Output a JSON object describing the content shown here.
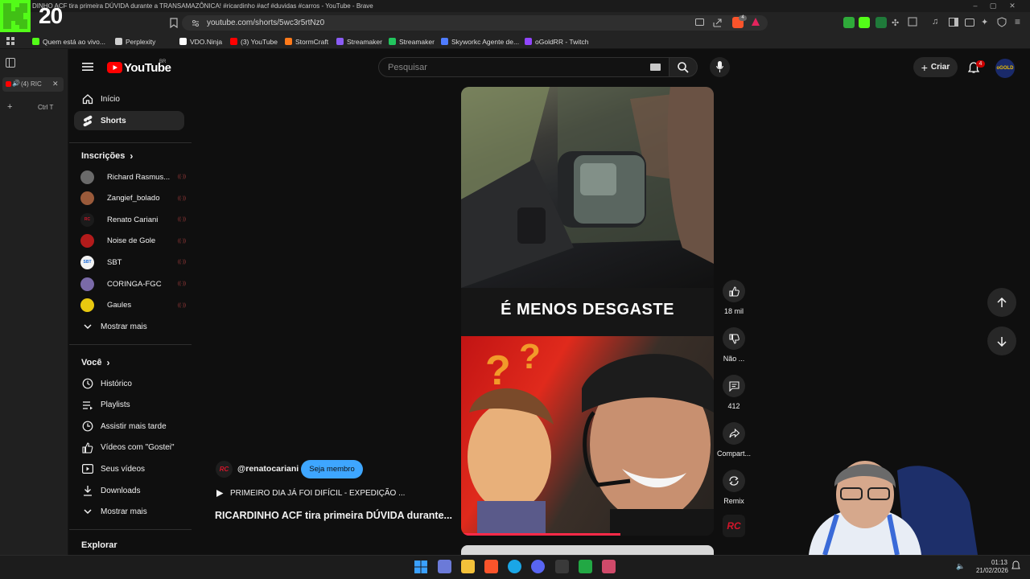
{
  "browser": {
    "window_title": "DINHO ACF tira primeira DÚVIDA durante a TRANSAMAZÔNICA! #ricardinho #acf #duvidas #carros - YouTube - Brave",
    "url": "youtube.com/shorts/5wc3r5rtNz0",
    "bookmarks": [
      {
        "label": "Quem está ao vivo...",
        "color": "#53fc18"
      },
      {
        "label": "Perplexity",
        "color": "#cfcfcf"
      },
      {
        "label": "VDO.Ninja",
        "color": "#ffffff"
      },
      {
        "label": "(3) YouTube",
        "color": "#ff0000"
      },
      {
        "label": "StormCraft",
        "color": "#ff7a1a"
      },
      {
        "label": "Streamaker",
        "color": "#8b5cf6"
      },
      {
        "label": "Streamaker",
        "color": "#22c55e"
      },
      {
        "label": "Skyworkc Agente de...",
        "color": "#4f7cff"
      },
      {
        "label": "oGoldRR - Twitch",
        "color": "#9146ff"
      }
    ],
    "tab": {
      "label": "(4) RIC",
      "new_tab_shortcut": "Ctrl T"
    },
    "shield_count": "4"
  },
  "overlay": {
    "count": "20",
    "brand_color": "#53fc18"
  },
  "youtube": {
    "logo": "YouTube",
    "country": "BR",
    "search_placeholder": "Pesquisar",
    "create_label": "Criar",
    "notifications": "4",
    "avatar_text": "oGOLD"
  },
  "sidebar": {
    "main": [
      {
        "label": "Início",
        "icon": "home-icon"
      },
      {
        "label": "Shorts",
        "icon": "shorts-icon",
        "active": true
      }
    ],
    "subscriptions_title": "Inscrições",
    "subscriptions": [
      {
        "label": "Richard Rasmus...",
        "color": "#6a6a6a",
        "mark": ""
      },
      {
        "label": "Zangief_bolado",
        "color": "#9a5a3a",
        "mark": ""
      },
      {
        "label": "Renato Cariani",
        "color": "#1b1b1b",
        "mark": "RC"
      },
      {
        "label": "Noise de Gole",
        "color": "#b31b1b",
        "mark": ""
      },
      {
        "label": "SBT",
        "color": "#f2f2f2",
        "mark": "SBT"
      },
      {
        "label": "CORINGA-FGC",
        "color": "#7a6aa8",
        "mark": ""
      },
      {
        "label": "Gaules",
        "color": "#e8c810",
        "mark": ""
      }
    ],
    "show_more": "Mostrar mais",
    "you_title": "Você",
    "you": [
      {
        "label": "Histórico",
        "icon": "history-icon"
      },
      {
        "label": "Playlists",
        "icon": "playlist-icon"
      },
      {
        "label": "Assistir mais tarde",
        "icon": "clock-icon"
      },
      {
        "label": "Vídeos com \"Gostei\"",
        "icon": "like-icon"
      },
      {
        "label": "Seus vídeos",
        "icon": "video-icon"
      },
      {
        "label": "Downloads",
        "icon": "download-icon"
      },
      {
        "label": "Mostrar mais",
        "icon": "chevron-down-icon"
      }
    ],
    "explore_title": "Explorar"
  },
  "short": {
    "caption": "É MENOS DESGASTE",
    "progress_percent": 63,
    "channel_handle": "@renatocariani",
    "channel_mark": "RC",
    "member_button": "Seja membro",
    "playlist_title": "PRIMEIRO DIA JÁ FOI DIFÍCIL - EXPEDIÇÃO ...",
    "title": "RICARDINHO ACF tira primeira DÚVIDA durante...",
    "actions": {
      "likes": "18 mil",
      "dislike": "Não ...",
      "comments": "412",
      "share": "Compart...",
      "remix": "Remix"
    }
  },
  "taskbar": {
    "time": "01:13",
    "date": "21/02/2026"
  }
}
